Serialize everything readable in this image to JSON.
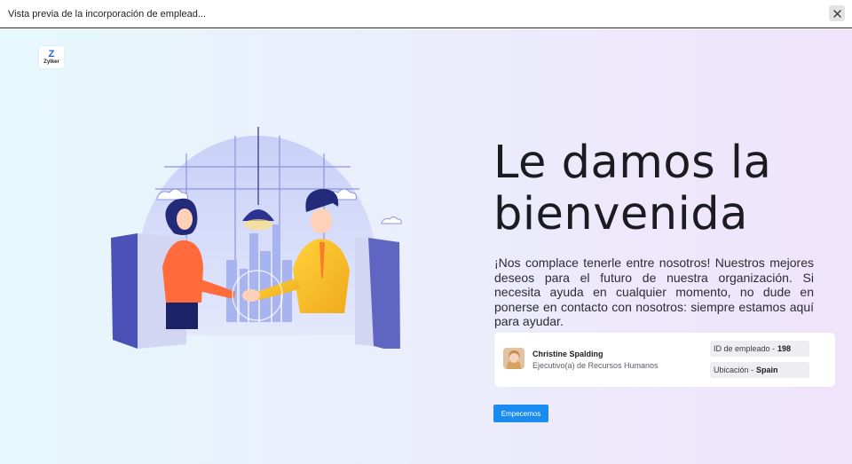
{
  "window": {
    "title": "Vista previa de la incorporación de emplead...",
    "close_icon": "close-icon"
  },
  "brand": {
    "logo_mark": "Z",
    "logo_text": "Zylker",
    "colors": {
      "logo_blue": "#1e62d6",
      "button_blue": "#1a8cf0"
    }
  },
  "welcome": {
    "heading": "Le damos la bienvenida",
    "message": "¡Nos complace tenerle entre nosotros! Nuestros mejores deseos para el futuro de nuestra organización. Si necesita ayuda en cualquier momento, no dude en ponerse en contacto con nosotros: siempre estamos aquí para ayudar."
  },
  "employee": {
    "name": "Christine Spalding",
    "role": "Ejecutivo(a) de Recursos Humanos",
    "id_label": "ID de empleado -",
    "id_value": "198",
    "location_label": "Ubicación -",
    "location_value": "Spain"
  },
  "actions": {
    "start_label": "Empecemos"
  }
}
